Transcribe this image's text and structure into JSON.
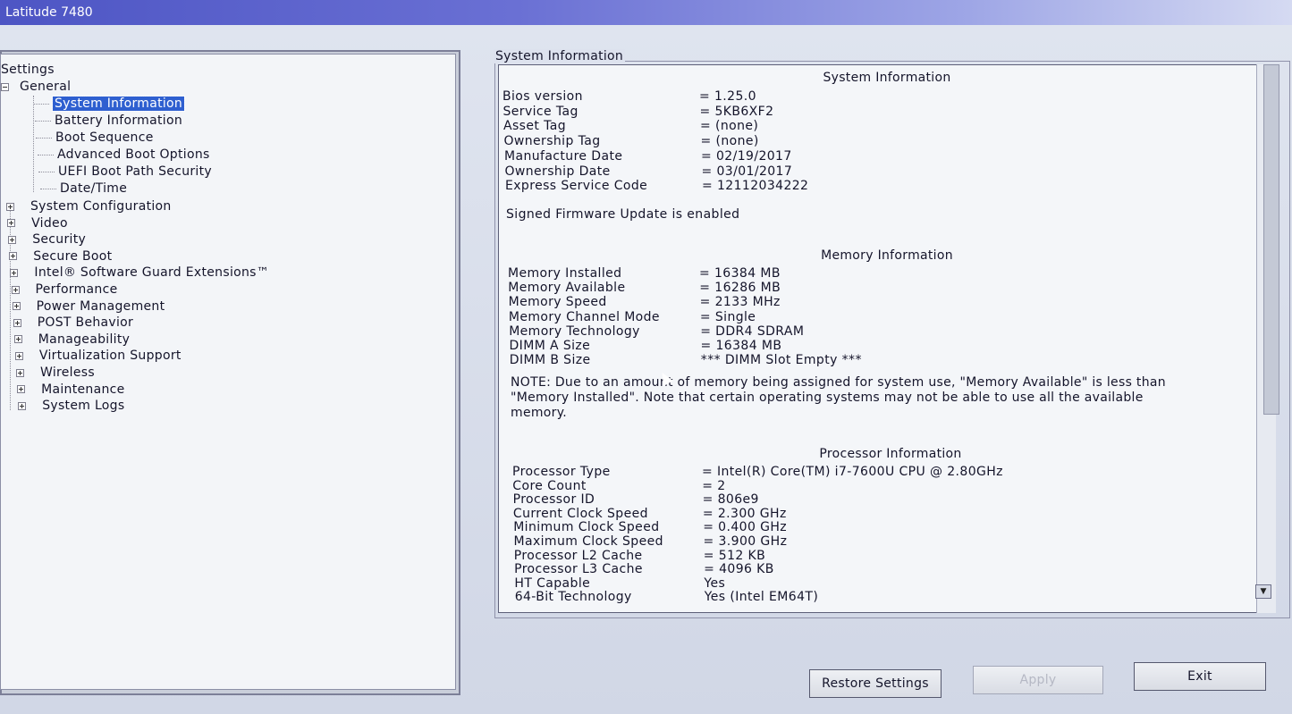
{
  "window": {
    "title": "Latitude 7480"
  },
  "tree": {
    "root": "Settings",
    "general": "General",
    "general_children": [
      "System Information",
      "Battery Information",
      "Boot Sequence",
      "Advanced Boot Options",
      "UEFI Boot Path Security",
      "Date/Time"
    ],
    "groups": [
      "System Configuration",
      "Video",
      "Security",
      "Secure Boot",
      "Intel® Software Guard Extensions™",
      "Performance",
      "Power Management",
      "POST Behavior",
      "Manageability",
      "Virtualization Support",
      "Wireless",
      "Maintenance",
      "System Logs"
    ]
  },
  "panel": {
    "legend": "System Information",
    "system_title": "System Information",
    "system_rows": [
      {
        "k": "Bios version",
        "v": "= 1.25.0"
      },
      {
        "k": "Service Tag",
        "v": "= 5KB6XF2"
      },
      {
        "k": "Asset Tag",
        "v": "= (none)"
      },
      {
        "k": "Ownership Tag",
        "v": "= (none)"
      },
      {
        "k": "Manufacture Date",
        "v": "= 02/19/2017"
      },
      {
        "k": "Ownership Date",
        "v": "= 03/01/2017"
      },
      {
        "k": "Express Service Code",
        "v": "= 12112034222"
      }
    ],
    "firmware_note": "Signed Firmware Update is enabled",
    "memory_title": "Memory Information",
    "memory_rows": [
      {
        "k": "Memory Installed",
        "v": "= 16384 MB"
      },
      {
        "k": "Memory Available",
        "v": "= 16286 MB"
      },
      {
        "k": "Memory Speed",
        "v": "= 2133 MHz"
      },
      {
        "k": "Memory Channel Mode",
        "v": "= Single"
      },
      {
        "k": "Memory Technology",
        "v": "= DDR4 SDRAM"
      },
      {
        "k": "DIMM A Size",
        "v": "= 16384 MB"
      },
      {
        "k": "DIMM B Size",
        "v": "*** DIMM Slot Empty ***"
      }
    ],
    "memory_note": "NOTE: Due to an amount of memory being assigned for system use, \"Memory Available\" is less than \"Memory Installed\". Note that certain operating systems may not be able to use all the available memory.",
    "processor_title": "Processor Information",
    "processor_rows": [
      {
        "k": "Processor Type",
        "v": "= Intel(R) Core(TM) i7-7600U CPU @ 2.80GHz"
      },
      {
        "k": "Core Count",
        "v": "= 2"
      },
      {
        "k": "Processor ID",
        "v": "= 806e9"
      },
      {
        "k": "Current Clock Speed",
        "v": "= 2.300 GHz"
      },
      {
        "k": "Minimum Clock Speed",
        "v": "= 0.400 GHz"
      },
      {
        "k": "Maximum Clock Speed",
        "v": "= 3.900 GHz"
      },
      {
        "k": "Processor L2 Cache",
        "v": "= 512 KB"
      },
      {
        "k": "Processor L3 Cache",
        "v": "= 4096 KB"
      },
      {
        "k": "HT Capable",
        "v": "Yes"
      },
      {
        "k": "64-Bit Technology",
        "v": "Yes (Intel EM64T)"
      }
    ]
  },
  "buttons": {
    "restore": "Restore Settings",
    "apply": "Apply",
    "exit": "Exit"
  }
}
